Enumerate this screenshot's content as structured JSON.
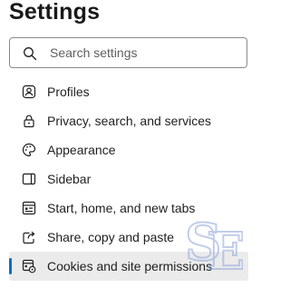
{
  "header": {
    "title": "Settings"
  },
  "search": {
    "placeholder": "Search settings",
    "icon": "search-icon"
  },
  "sidebar": {
    "items": [
      {
        "label": "Profiles",
        "icon": "profile-icon",
        "selected": false
      },
      {
        "label": "Privacy, search, and services",
        "icon": "lock-icon",
        "selected": false
      },
      {
        "label": "Appearance",
        "icon": "palette-icon",
        "selected": false
      },
      {
        "label": "Sidebar",
        "icon": "sidebar-icon",
        "selected": false
      },
      {
        "label": "Start, home, and new tabs",
        "icon": "home-tabs-icon",
        "selected": false
      },
      {
        "label": "Share, copy and paste",
        "icon": "share-icon",
        "selected": false
      },
      {
        "label": "Cookies and site permissions",
        "icon": "cookies-icon",
        "selected": true
      }
    ]
  },
  "watermark": {
    "text": "SE"
  },
  "colors": {
    "accent": "#0f6cbd",
    "selected_bg": "#ebebeb",
    "watermark": "#8fa6d8"
  }
}
